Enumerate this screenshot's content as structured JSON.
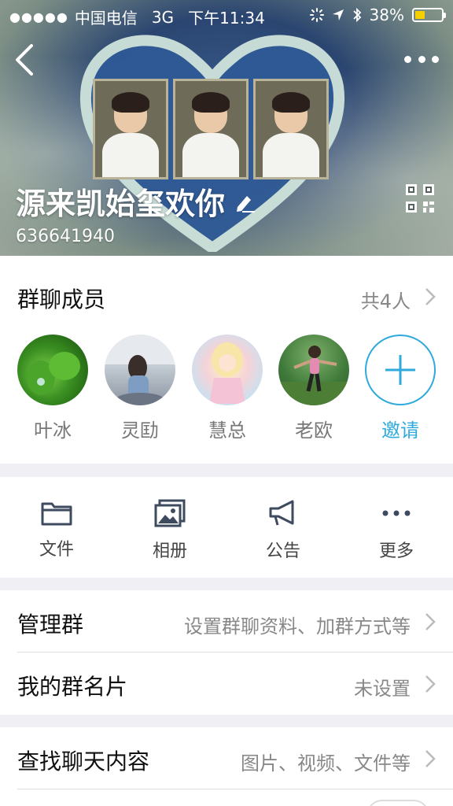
{
  "status_bar": {
    "signal": "●●●●●",
    "carrier": "中国电信",
    "network": "3G",
    "time": "下午11:34",
    "battery_percent": "38%",
    "battery_level": 0.38,
    "battery_color": "#f5d000"
  },
  "header": {
    "group_name": "源来凯始玺欢你",
    "group_id": "636641940",
    "back_icon": "chevron-left-icon",
    "more_icon": "more-dots-icon",
    "qr_icon": "qr-code-icon",
    "edit_icon": "pencil-icon"
  },
  "members": {
    "title": "群聊成员",
    "count_label": "共4人",
    "list": [
      {
        "name": "叶冰"
      },
      {
        "name": "灵劻"
      },
      {
        "name": "慧总"
      },
      {
        "name": "老欧"
      }
    ],
    "invite_label": "邀请",
    "accent": "#2eaadc"
  },
  "tools": [
    {
      "label": "文件",
      "icon": "folder-icon"
    },
    {
      "label": "相册",
      "icon": "photo-album-icon"
    },
    {
      "label": "公告",
      "icon": "megaphone-icon"
    },
    {
      "label": "更多",
      "icon": "more-dots-icon"
    }
  ],
  "settings": {
    "manage": {
      "title": "管理群",
      "value": "设置群聊资料、加群方式等"
    },
    "card": {
      "title": "我的群名片",
      "value": "未设置"
    }
  },
  "search": {
    "title": "查找聊天内容",
    "value": "图片、视频、文件等"
  }
}
